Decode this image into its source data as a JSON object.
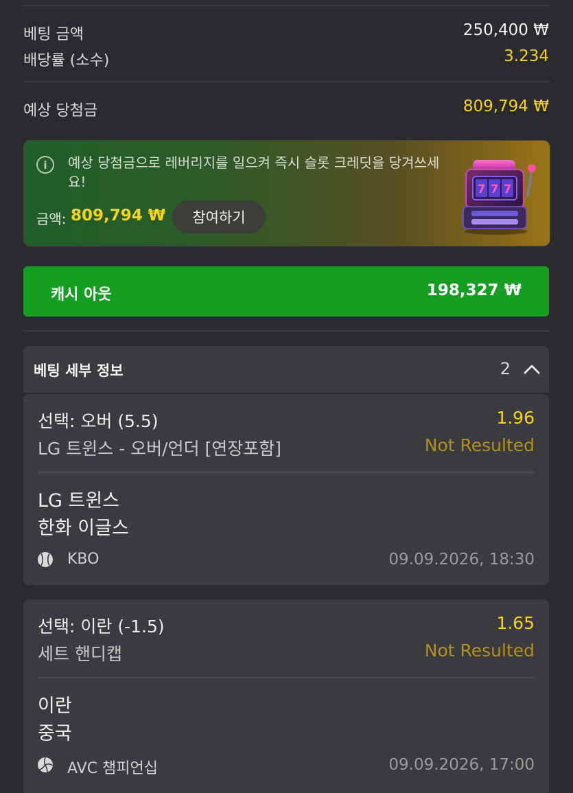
{
  "summary": {
    "bet_amount_label": "베팅 금액",
    "bet_amount_value": "250,400 ₩",
    "odds_label": "배당률 (소수)",
    "odds_value": "3.234",
    "expected_win_label": "예상 당첨금",
    "expected_win_value": "809,794 ₩"
  },
  "promo": {
    "info_icon": "info-circle-icon",
    "message": "예상 당첨금으로 레버리지를 일으켜 즉시 슬롯 크레딧을 당겨쓰세요!",
    "amount_label": "금액:",
    "amount_value": "809,794 ₩",
    "join_label": "참여하기",
    "image": "slot-machine-icon"
  },
  "cashout": {
    "label": "캐시 아웃",
    "value": "198,327 ₩",
    "color": "#159e22"
  },
  "details": {
    "title": "베팅 세부 정보",
    "count": "2",
    "toggle_icon": "chevron-up-icon"
  },
  "bets": [
    {
      "selection": "선택: 오버 (5.5)",
      "odds": "1.96",
      "market": "LG 트윈스 - 오버/언더 [연장포함]",
      "status": "Not Resulted",
      "team1": "LG 트윈스",
      "team2": "한화 이글스",
      "sport_icon": "baseball-icon",
      "league": "KBO",
      "datetime": "09.09.2026, 18:30"
    },
    {
      "selection": "선택: 이란 (-1.5)",
      "odds": "1.65",
      "market": "세트 핸디캡",
      "status": "Not Resulted",
      "team1": "이란",
      "team2": "중국",
      "sport_icon": "volleyball-icon",
      "league": "AVC 챔피언십",
      "datetime": "09.09.2026, 17:00"
    }
  ],
  "colors": {
    "background": "#2a2b2e",
    "card": "#3a3b3f",
    "accent_yellow": "#f7d21b",
    "status_gold": "#b58f1a"
  }
}
